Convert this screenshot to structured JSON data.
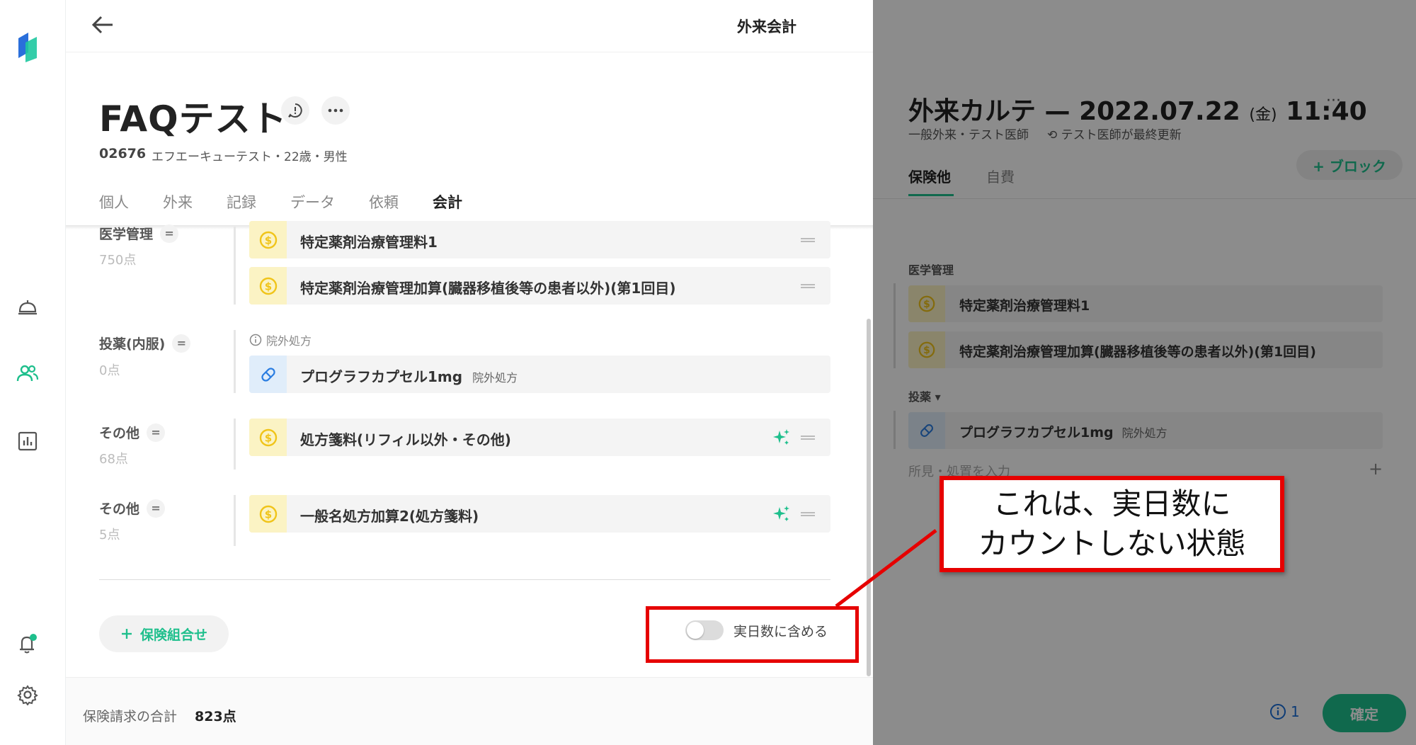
{
  "topbar": {
    "title": "外来会計"
  },
  "patient": {
    "name": "FAQテスト",
    "id": "02676",
    "info": "エフエーキューテスト・22歳・男性"
  },
  "tabs": [
    "個人",
    "外来",
    "記録",
    "データ",
    "依頼",
    "会計"
  ],
  "active_tab": "会計",
  "sections": {
    "management": {
      "title": "医学管理",
      "points": "750点",
      "items": [
        "特定薬剤治療管理料1",
        "特定薬剤治療管理加算(臓器移植後等の患者以外)(第1回目)"
      ]
    },
    "medication": {
      "title": "投薬(内服)",
      "points": "0点",
      "note": "院外処方",
      "item": "プログラフカプセル1mg",
      "item_sub": "院外処方"
    },
    "other1": {
      "title": "その他",
      "points": "68点",
      "item": "処方箋料(リフィル以外・その他)"
    },
    "other2": {
      "title": "その他",
      "points": "5点",
      "item": "一般名処方加算2(処方箋料)"
    }
  },
  "insurance_button": "保険組合せ",
  "toggle": {
    "label": "実日数に含める",
    "on": false
  },
  "footer": {
    "label": "保険請求の合計",
    "value": "823点"
  },
  "right_panel": {
    "title_main": "外来カルテ — 2022.07.22",
    "title_day": "(金)",
    "title_time": "11:40",
    "more": "···",
    "subtitle": "一般外来・テスト医師",
    "updated": "テスト医師が最終更新",
    "block_button": "+ ブロック",
    "tabs": [
      "保険他",
      "自費"
    ],
    "section_management": "医学管理",
    "items": [
      "特定薬剤治療管理料1",
      "特定薬剤治療管理加算(臓器移植後等の患者以外)(第1回目)"
    ],
    "section_medication": "投薬",
    "med_item": "プログラフカプセル1mg",
    "med_item_sub": "院外処方",
    "input_placeholder": "所見・処置を入力",
    "plus": "+",
    "info_count": "1",
    "confirm": "確定"
  },
  "annotation": {
    "line1": "これは、実日数に",
    "line2": "カウントしない状態"
  },
  "colors": {
    "accent": "#1ebf8c",
    "highlight": "#e60000",
    "coin": "#f5c518"
  }
}
